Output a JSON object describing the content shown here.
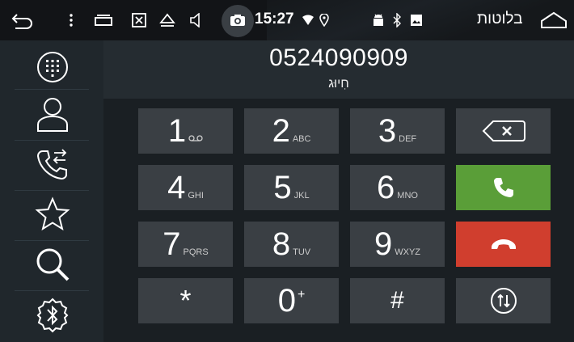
{
  "status_bar": {
    "time": "15:27",
    "language": "בלוטות",
    "icons": [
      "back-icon",
      "menu-dots-icon",
      "recent-apps-icon",
      "close-box-icon",
      "eject-icon",
      "volume-icon",
      "camera-icon",
      "wifi-icon",
      "location-icon",
      "android-icon",
      "bluetooth-icon",
      "image-icon",
      "home-icon"
    ]
  },
  "sidebar": {
    "items": [
      "dialpad-icon",
      "contacts-icon",
      "call-log-icon",
      "favorites-icon",
      "search-icon",
      "bluetooth-settings-icon"
    ]
  },
  "dialer": {
    "number": "0524090909",
    "status": "חִיוּג"
  },
  "keypad": {
    "k1": {
      "digit": "1",
      "letters": "ₒₒ"
    },
    "k2": {
      "digit": "2",
      "letters": "ABC"
    },
    "k3": {
      "digit": "3",
      "letters": "DEF"
    },
    "k4": {
      "digit": "4",
      "letters": "GHI"
    },
    "k5": {
      "digit": "5",
      "letters": "JKL"
    },
    "k6": {
      "digit": "6",
      "letters": "MNO"
    },
    "k7": {
      "digit": "7",
      "letters": "PQRS"
    },
    "k8": {
      "digit": "8",
      "letters": "TUV"
    },
    "k9": {
      "digit": "9",
      "letters": "WXYZ"
    },
    "star": "*",
    "k0": {
      "digit": "0",
      "extra": "+"
    },
    "hash": "#"
  },
  "colors": {
    "call": "#5a9e38",
    "end": "#d03e2e",
    "key": "#3a3f44",
    "sidebar": "#20272c"
  }
}
